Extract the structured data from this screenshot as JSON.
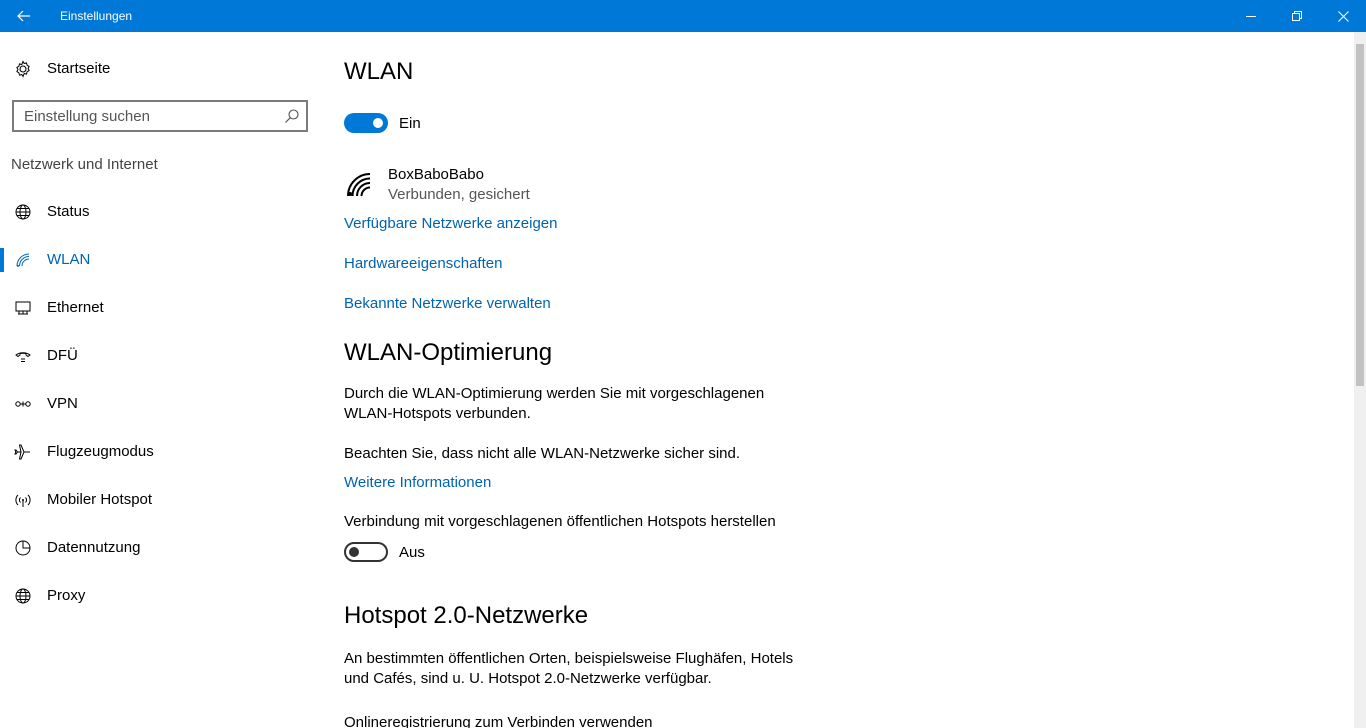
{
  "window": {
    "title": "Einstellungen",
    "accent_color": "#0078d7",
    "back_icon": "arrow-left-icon",
    "minimize_icon": "minimize-icon",
    "restore_icon": "restore-icon",
    "close_icon": "close-icon"
  },
  "sidebar": {
    "home_label": "Startseite",
    "search_placeholder": "Einstellung suchen",
    "section_label": "Netzwerk und Internet",
    "items": [
      {
        "label": "Status",
        "icon": "globe-icon",
        "active": false
      },
      {
        "label": "WLAN",
        "icon": "wifi-icon",
        "active": true
      },
      {
        "label": "Ethernet",
        "icon": "ethernet-icon",
        "active": false
      },
      {
        "label": "DFÜ",
        "icon": "dial-up-icon",
        "active": false
      },
      {
        "label": "VPN",
        "icon": "vpn-icon",
        "active": false
      },
      {
        "label": "Flugzeugmodus",
        "icon": "airplane-icon",
        "active": false
      },
      {
        "label": "Mobiler Hotspot",
        "icon": "hotspot-icon",
        "active": false
      },
      {
        "label": "Datennutzung",
        "icon": "data-usage-icon",
        "active": false
      },
      {
        "label": "Proxy",
        "icon": "globe-icon",
        "active": false
      }
    ]
  },
  "main": {
    "wlan_title": "WLAN",
    "wlan_toggle": {
      "state": "on",
      "label": "Ein"
    },
    "network": {
      "name": "BoxBaboBabo",
      "status": "Verbunden, gesichert"
    },
    "links": {
      "available_networks": "Verfügbare Netzwerke anzeigen",
      "hardware_properties": "Hardwareeigenschaften",
      "manage_known": "Bekannte Netzwerke verwalten"
    },
    "optimization": {
      "title": "WLAN-Optimierung",
      "description": "Durch die WLAN-Optimierung werden Sie mit vorgeschlagenen WLAN-Hotspots verbunden.",
      "warning": "Beachten Sie, dass nicht alle WLAN-Netzwerke sicher sind.",
      "more_info_link": "Weitere Informationen",
      "hotspot_setting_label": "Verbindung mit vorgeschlagenen öffentlichen Hotspots herstellen",
      "hotspot_toggle": {
        "state": "off",
        "label": "Aus"
      }
    },
    "hotspot20": {
      "title": "Hotspot 2.0-Netzwerke",
      "description": "An bestimmten öffentlichen Orten, beispielsweise Flughäfen, Hotels und Cafés, sind u. U. Hotspot 2.0-Netzwerke verfügbar.",
      "online_registration": "Onlineregistrierung zum Verbinden verwenden"
    }
  }
}
